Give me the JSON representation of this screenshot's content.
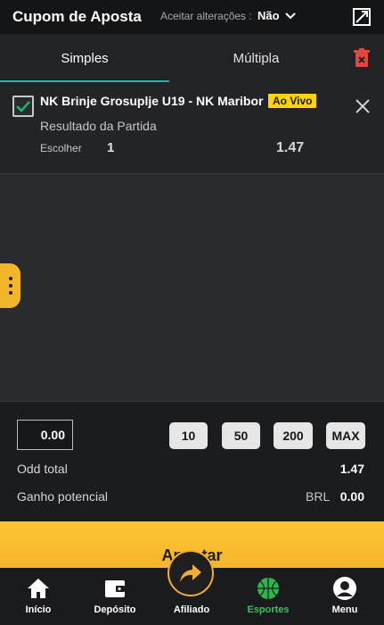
{
  "header": {
    "title": "Cupom de Aposta",
    "accept_label": "Aceitar alterações :",
    "accept_value": "Não"
  },
  "tabs": [
    {
      "label": "Simples",
      "active": true
    },
    {
      "label": "Múltipla",
      "active": false
    }
  ],
  "bet": {
    "match": "NK Brinje Grosuplje U19 - NK Maribor",
    "live_badge": "Ao Vivo",
    "market": "Resultado da Partida",
    "choose_label": "Escolher",
    "pick": "1",
    "odd": "1.47",
    "checked": true
  },
  "stake": {
    "value": "0.00",
    "quick_amounts": [
      "10",
      "50",
      "200",
      "MAX"
    ]
  },
  "summary": {
    "odd_total_label": "Odd total",
    "odd_total_value": "1.47",
    "gain_label": "Ganho potencial",
    "gain_currency": "BRL",
    "gain_value": "0.00"
  },
  "bet_button": "Apostar",
  "nav": [
    {
      "label": "Início",
      "icon": "home-icon"
    },
    {
      "label": "Depósito",
      "icon": "wallet-icon"
    },
    {
      "label": "Afiliado",
      "icon": "share-arrow-icon"
    },
    {
      "label": "Esportes",
      "icon": "basketball-icon",
      "active": true
    },
    {
      "label": "Menu",
      "icon": "user-icon"
    }
  ],
  "colors": {
    "accent_teal": "#1bb9a5",
    "brand_yellow": "#f4b52c",
    "live_yellow": "#ffd400",
    "active_green": "#39c35a",
    "delete_red": "#e0473f"
  }
}
